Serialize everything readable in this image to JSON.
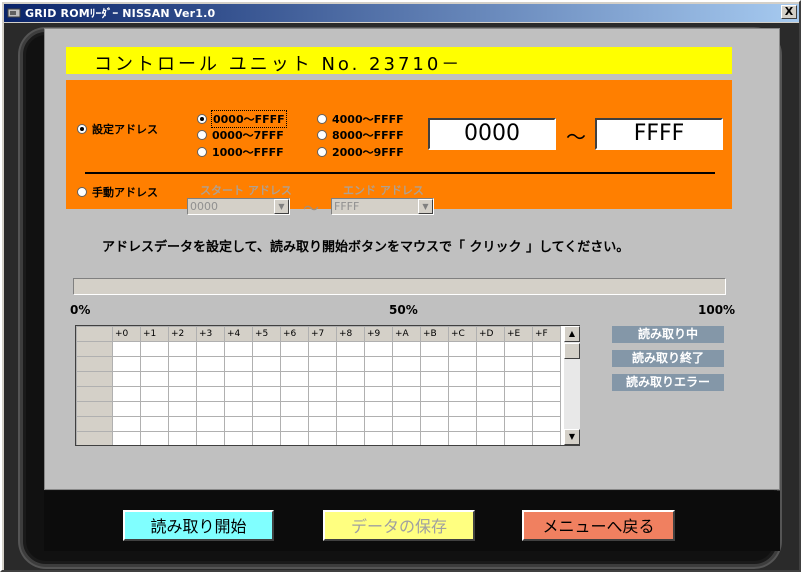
{
  "window": {
    "title": "GRID ROMﾘｰﾀﾞｰ NISSAN Ver1.0",
    "close_label": "X"
  },
  "unit": {
    "text": "コントロール ユニット No.  23710－"
  },
  "address_mode": {
    "set_label": "設定アドレス",
    "manual_label": "手動アドレス",
    "selected": "set"
  },
  "ranges": [
    {
      "label": "0000～FFFF",
      "selected": true
    },
    {
      "label": "0000～7FFF",
      "selected": false
    },
    {
      "label": "1000～FFFF",
      "selected": false
    },
    {
      "label": "4000～FFFF",
      "selected": false
    },
    {
      "label": "8000～FFFF",
      "selected": false
    },
    {
      "label": "2000～9FFF",
      "selected": false
    }
  ],
  "address_range": {
    "start": "0000",
    "end": "FFFF",
    "separator": "～"
  },
  "manual": {
    "start_label": "スタート アドレス",
    "end_label": "エンド アドレス",
    "start_value": "0000",
    "end_value": "FFFF",
    "separator": "～"
  },
  "instruction": "アドレスデータを設定して、読み取り開始ボタンをマウスで「 クリック 」してください。",
  "progress": {
    "value": 0,
    "label_min": "0%",
    "label_mid": "50%",
    "label_max": "100%"
  },
  "grid": {
    "columns": [
      "+0",
      "+1",
      "+2",
      "+3",
      "+4",
      "+5",
      "+6",
      "+7",
      "+8",
      "+9",
      "+A",
      "+B",
      "+C",
      "+D",
      "+E",
      "+F"
    ]
  },
  "status": {
    "reading": "読み取り中",
    "done": "読み取り終了",
    "error": "読み取りエラー"
  },
  "buttons": {
    "start": "読み取り開始",
    "save": "データの保存",
    "back": "メニューへ戻る"
  },
  "colors": {
    "unit_bar": "#ffff00",
    "panel": "#ff7f00",
    "start_button": "#80ffff",
    "save_button": "#ffff80",
    "back_button": "#f08060",
    "status_badge": "#8497a8"
  }
}
